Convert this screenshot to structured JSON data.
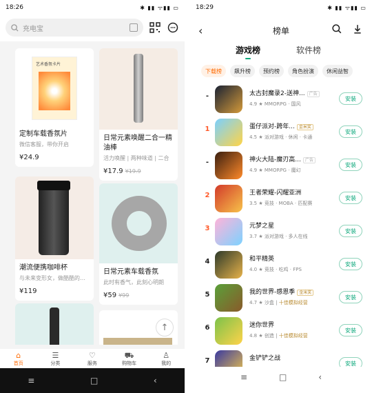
{
  "left": {
    "status": {
      "time": "18:26",
      "icons": "✱ ▮▮ ᯤ▮▮ ▭"
    },
    "search": {
      "placeholder": "充电宝"
    },
    "products": [
      {
        "title": "定制车载香氛片",
        "sub": "微信客服，带你开启",
        "price": "¥24.9",
        "old": "",
        "img_label": "艺术香氛卡片",
        "colors": [
          "#ffe28a",
          "#ff8c3a"
        ]
      },
      {
        "title": "日常元素唤醒二合一精油棒",
        "sub": "活力唤醒 | 两种味道 | 二合",
        "price": "¥17.9",
        "old": "¥19.9",
        "img_label": "",
        "colors": [
          "#f3e9df",
          "#9a9a9a"
        ]
      },
      {
        "title": "潮流便携咖啡杯",
        "sub": "与未来变形女，做酷酷的自己",
        "price": "¥119",
        "old": "",
        "img_label": "",
        "colors": [
          "#f4ece6",
          "#333333"
        ]
      },
      {
        "title": "日常元素车载香氛",
        "sub": "此时有香气，此刻心明朗",
        "price": "¥59",
        "old": "¥99",
        "img_label": "",
        "colors": [
          "#dff0ee",
          "#9a9a9a"
        ]
      },
      {
        "title": "",
        "sub": "",
        "price": "",
        "old": "",
        "img_label": "",
        "colors": [
          "#dff0ee",
          "#2a2a2a"
        ]
      },
      {
        "title": "",
        "sub": "",
        "price": "",
        "old": "",
        "img_label": "",
        "colors": [
          "#ffffff",
          "#c9b48a"
        ]
      }
    ],
    "tabs": [
      {
        "label": "首页",
        "icon": "⌂"
      },
      {
        "label": "分类",
        "icon": "☰"
      },
      {
        "label": "服务",
        "icon": "♡"
      },
      {
        "label": "购物车",
        "icon": "⛟"
      },
      {
        "label": "我的",
        "icon": "♙"
      }
    ],
    "nav": [
      "≡",
      "□",
      "‹"
    ]
  },
  "right": {
    "status": {
      "time": "18:29",
      "icons": "✱ ▮▮ ᯤ▮▮ ▭"
    },
    "title": "榜单",
    "main_tabs": [
      "游戏榜",
      "软件榜"
    ],
    "chips": [
      "下载榜",
      "飙升榜",
      "预约榜",
      "角色扮演",
      "休闲益智"
    ],
    "install_label": "安装",
    "apps": [
      {
        "rank": "-",
        "name": "太古封魔录2-送神...",
        "tag": "广告",
        "tag_type": "ad",
        "rating": "4.9",
        "meta": "MMORPG · 国风",
        "meta_gold": "",
        "colors": [
          "#1a2233",
          "#d49a3a"
        ]
      },
      {
        "rank": "1",
        "name": "蛋仔派对-跨年...",
        "tag": "金米奖",
        "tag_type": "badge",
        "rating": "4.5",
        "meta": "派对游戏 · 休闲 · 卡通",
        "meta_gold": "",
        "colors": [
          "#7ad0ff",
          "#ffd447"
        ]
      },
      {
        "rank": "-",
        "name": "神火大陆-魔刃高...",
        "tag": "广告",
        "tag_type": "ad",
        "rating": "4.9",
        "meta": "MMORPG · 魔幻",
        "meta_gold": "",
        "colors": [
          "#3a1f10",
          "#ff8a2a"
        ]
      },
      {
        "rank": "2",
        "name": "王者荣耀-闪耀亚洲",
        "tag": "",
        "tag_type": "",
        "rating": "3.5",
        "meta": "竞技 · MOBA · 匹配赛",
        "meta_gold": "",
        "colors": [
          "#d23a2a",
          "#f7c24a"
        ]
      },
      {
        "rank": "3",
        "name": "元梦之星",
        "tag": "",
        "tag_type": "",
        "rating": "3.7",
        "meta": "派对游戏 · 多人在线",
        "meta_gold": "",
        "colors": [
          "#ffb3d9",
          "#7dd2ff"
        ]
      },
      {
        "rank": "4",
        "name": "和平精英",
        "tag": "",
        "tag_type": "",
        "rating": "4.0",
        "meta": "竞技 · 吃鸡 · FPS",
        "meta_gold": "",
        "colors": [
          "#2d3a2a",
          "#e7b24a"
        ]
      },
      {
        "rank": "5",
        "name": "我的世界-感恩季",
        "tag": "金米奖",
        "tag_type": "badge",
        "rating": "4.7",
        "meta": "沙盒 |",
        "meta_gold": "十佳模拟经营",
        "colors": [
          "#5aa03a",
          "#8a5a2a"
        ]
      },
      {
        "rank": "6",
        "name": "迷你世界",
        "tag": "",
        "tag_type": "",
        "rating": "4.8",
        "meta": "创造 |",
        "meta_gold": "十佳模拟经营",
        "colors": [
          "#7cc24a",
          "#ffd34a"
        ]
      },
      {
        "rank": "7",
        "name": "金铲铲之战",
        "tag": "",
        "tag_type": "",
        "rating": "",
        "meta": "",
        "meta_gold": "",
        "colors": [
          "#3a3aa0",
          "#f2c84a"
        ]
      }
    ],
    "nav": [
      "≡",
      "□",
      "‹"
    ]
  }
}
